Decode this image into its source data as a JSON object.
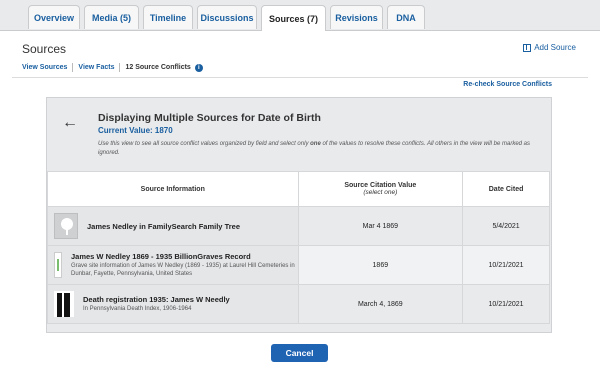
{
  "tabs": [
    {
      "label": "Overview",
      "active": false
    },
    {
      "label": "Media (5)",
      "active": false
    },
    {
      "label": "Timeline",
      "active": false
    },
    {
      "label": "Discussions",
      "active": false
    },
    {
      "label": "Sources (7)",
      "active": true
    },
    {
      "label": "Revisions",
      "active": false
    },
    {
      "label": "DNA",
      "active": false
    }
  ],
  "header": {
    "title": "Sources",
    "add_source": "Add Source"
  },
  "subnav": {
    "view_sources": "View Sources",
    "view_facts": "View Facts",
    "conflicts": "12 Source Conflicts",
    "info_icon": "i"
  },
  "recheck": "Re-check Source Conflicts",
  "panel": {
    "back_icon": "←",
    "title": "Displaying Multiple Sources for Date of Birth",
    "current_value": "Current Value: 1870",
    "instructions_pre": "Use this view to see all source conflict values organized by field and select only ",
    "instructions_bold": "one",
    "instructions_post": " of the values to resolve these conflicts. All others in the view will be marked as ignored."
  },
  "table": {
    "headers": {
      "source": "Source Information",
      "citation": "Source Citation Value",
      "citation_sub": "(select one)",
      "date": "Date Cited"
    },
    "rows": [
      {
        "thumb": "tree-icon",
        "title": "James Nedley in FamilySearch Family Tree",
        "desc": "",
        "value": "Mar 4 1869",
        "date": "5/4/2021"
      },
      {
        "thumb": "grave-icon",
        "title": "James W Nedley 1869 - 1935 BillionGraves Record",
        "desc": "Grave site information of James W Nedley (1869 - 1935) at Laurel Hill Cemeteries in Dunbar, Fayette, Pennsylvania, United States",
        "value": "1869",
        "date": "10/21/2021"
      },
      {
        "thumb": "document-icon",
        "title": "Death registration 1935: James W Needly",
        "desc": "In Pennsylvania Death Index, 1906-1964",
        "value": "March 4, 1869",
        "date": "10/21/2021"
      }
    ]
  },
  "cancel": "Cancel"
}
